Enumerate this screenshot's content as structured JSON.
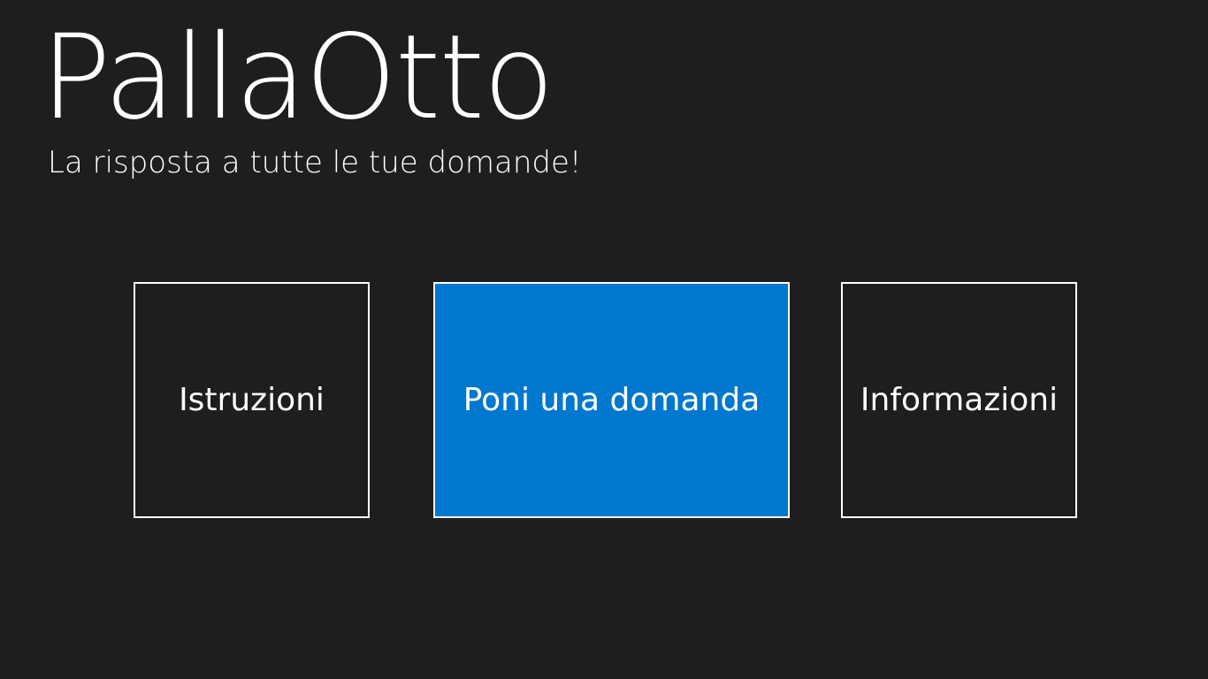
{
  "app": {
    "title": "PallaOtto",
    "subtitle": "La risposta a tutte le tue domande!"
  },
  "tiles": [
    {
      "label": "Istruzioni",
      "background": "#1e1e1e"
    },
    {
      "label": "Poni una domanda",
      "background": "#0078cf"
    },
    {
      "label": "Informazioni",
      "background": "#1e1e1e"
    }
  ],
  "colors": {
    "background": "#1e1e1e",
    "accent": "#0078cf",
    "text": "#ffffff"
  }
}
